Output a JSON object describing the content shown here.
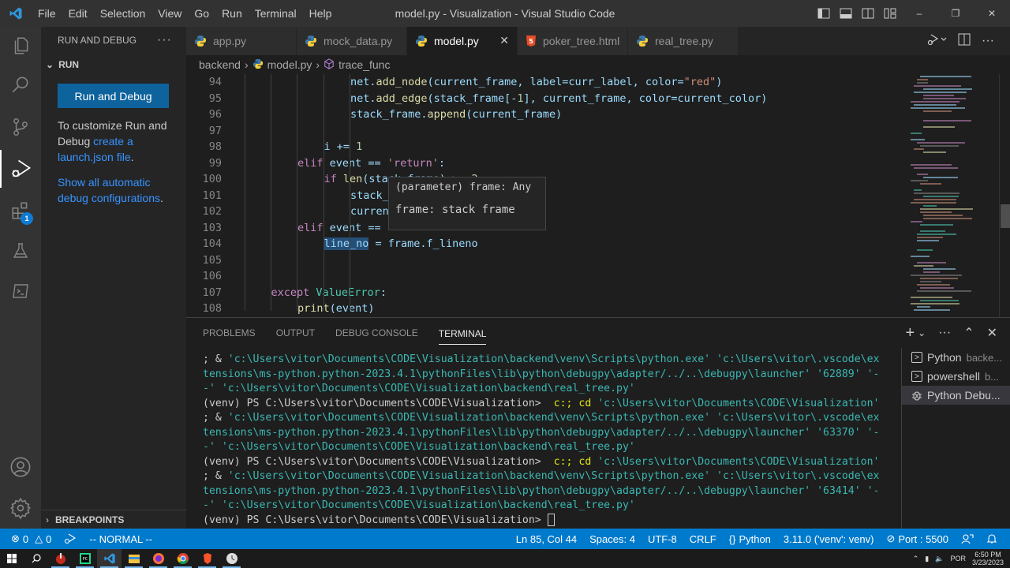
{
  "titlebar": {
    "menu": [
      "File",
      "Edit",
      "Selection",
      "View",
      "Go",
      "Run",
      "Terminal",
      "Help"
    ],
    "title": "model.py - Visualization - Visual Studio Code"
  },
  "activity_bar": {
    "items": [
      "explorer-icon",
      "search-icon",
      "source-control-icon",
      "run-debug-icon",
      "extensions-icon",
      "testing-icon",
      "remote-explorer-icon"
    ],
    "extensions_badge": "1",
    "bottom": [
      "accounts-icon",
      "manage-gear-icon"
    ]
  },
  "sidebar": {
    "title": "RUN AND DEBUG",
    "more": "···",
    "section": "RUN",
    "run_button": "Run and Debug",
    "text1_prefix": "To customize Run and Debug ",
    "text1_link": "create a launch.json file",
    "text1_suffix": ".",
    "text2_link": "Show all automatic debug configurations",
    "text2_suffix": ".",
    "breakpoints": "BREAKPOINTS"
  },
  "tabs": [
    {
      "label": "app.py",
      "icon": "python-icon",
      "active": false
    },
    {
      "label": "mock_data.py",
      "icon": "python-icon",
      "active": false
    },
    {
      "label": "model.py",
      "icon": "python-icon",
      "active": true
    },
    {
      "label": "poker_tree.html",
      "icon": "html5-icon",
      "active": false
    },
    {
      "label": "real_tree.py",
      "icon": "python-icon",
      "active": false
    }
  ],
  "breadcrumb": {
    "folder": "backend",
    "file": "model.py",
    "symbol": "trace_func"
  },
  "editor": {
    "line_numbers": [
      "94",
      "95",
      "96",
      "97",
      "98",
      "99",
      "100",
      "101",
      "102",
      "103",
      "104",
      "105",
      "106",
      "107",
      "108"
    ],
    "lines": [
      "net.add_node(current_frame, label=curr_label, color=\"red\")",
      "net.add_edge(stack_frame[-1], current_frame, color=current_color)",
      "stack_frame.append(current_frame)",
      "",
      "i += 1",
      "elif event == 'return':",
      "if len(stack_frame) >= 2:",
      "stack_",
      "curren",
      "elif event ==",
      "line_no = frame.f_lineno",
      "",
      "",
      "except ValueError:",
      "print(event)"
    ],
    "hover": {
      "signature": "(parameter) frame: Any",
      "doc": "frame: stack frame"
    }
  },
  "panel": {
    "tabs": [
      "PROBLEMS",
      "OUTPUT",
      "DEBUG CONSOLE",
      "TERMINAL"
    ],
    "active_tab": "TERMINAL",
    "terminal_lines": [
      {
        "a": "; & ",
        "b": "'c:\\Users\\vitor\\Documents\\CODE\\Visualization\\backend\\venv\\Scripts\\python.exe' 'c:\\Users\\vitor\\.vscode\\ex"
      },
      {
        "a": "",
        "b": "tensions\\ms-python.python-2023.4.1\\pythonFiles\\lib\\python\\debugpy\\adapter/../..\\debugpy\\launcher' '62889' '-"
      },
      {
        "a": "",
        "b": "-' 'c:\\Users\\vitor\\Documents\\CODE\\Visualization\\backend\\real_tree.py'"
      },
      {
        "a": "(venv) PS C:\\Users\\vitor\\Documents\\CODE\\Visualization>  ",
        "y": "c:; cd ",
        "b": "'c:\\Users\\vitor\\Documents\\CODE\\Visualization'"
      },
      {
        "a": "; & ",
        "b": "'c:\\Users\\vitor\\Documents\\CODE\\Visualization\\backend\\venv\\Scripts\\python.exe' 'c:\\Users\\vitor\\.vscode\\ex"
      },
      {
        "a": "",
        "b": "tensions\\ms-python.python-2023.4.1\\pythonFiles\\lib\\python\\debugpy\\adapter/../..\\debugpy\\launcher' '63370' '-"
      },
      {
        "a": "",
        "b": "-' 'c:\\Users\\vitor\\Documents\\CODE\\Visualization\\backend\\real_tree.py'"
      },
      {
        "a": "(venv) PS C:\\Users\\vitor\\Documents\\CODE\\Visualization>  ",
        "y": "c:; cd ",
        "b": "'c:\\Users\\vitor\\Documents\\CODE\\Visualization'"
      },
      {
        "a": "; & ",
        "b": "'c:\\Users\\vitor\\Documents\\CODE\\Visualization\\backend\\venv\\Scripts\\python.exe' 'c:\\Users\\vitor\\.vscode\\ex"
      },
      {
        "a": "",
        "b": "tensions\\ms-python.python-2023.4.1\\pythonFiles\\lib\\python\\debugpy\\adapter/../..\\debugpy\\launcher' '63414' '-"
      },
      {
        "a": "",
        "b": "-' 'c:\\Users\\vitor\\Documents\\CODE\\Visualization\\backend\\real_tree.py'"
      },
      {
        "a": "(venv) PS C:\\Users\\vitor\\Documents\\CODE\\Visualization> ",
        "cursor": true
      }
    ],
    "terminals": [
      {
        "name": "Python",
        "detail": "backe...",
        "icon": "terminal-icon"
      },
      {
        "name": "powershell",
        "detail": "b...",
        "icon": "terminal-icon"
      },
      {
        "name": "Python Debu...",
        "detail": "",
        "icon": "debug-icon",
        "active": true
      }
    ]
  },
  "statusbar": {
    "errors": "0",
    "warnings": "0",
    "mode": "-- NORMAL --",
    "position": "Ln 85, Col 44",
    "spaces": "Spaces: 4",
    "encoding": "UTF-8",
    "eol": "CRLF",
    "language": "Python",
    "interpreter": "3.11.0 ('venv': venv)",
    "port": "Port : 5500"
  },
  "taskbar": {
    "apps": [
      "windows-start",
      "search",
      "app-red",
      "pycharm",
      "vscode",
      "file-explorer",
      "firefox",
      "chrome",
      "brave",
      "clock-app"
    ],
    "lang": "POR",
    "time": "6:50 PM",
    "date": "3/23/2023"
  },
  "colors": {
    "accent": "#007acc",
    "button": "#0e639c",
    "link": "#3794ff"
  }
}
